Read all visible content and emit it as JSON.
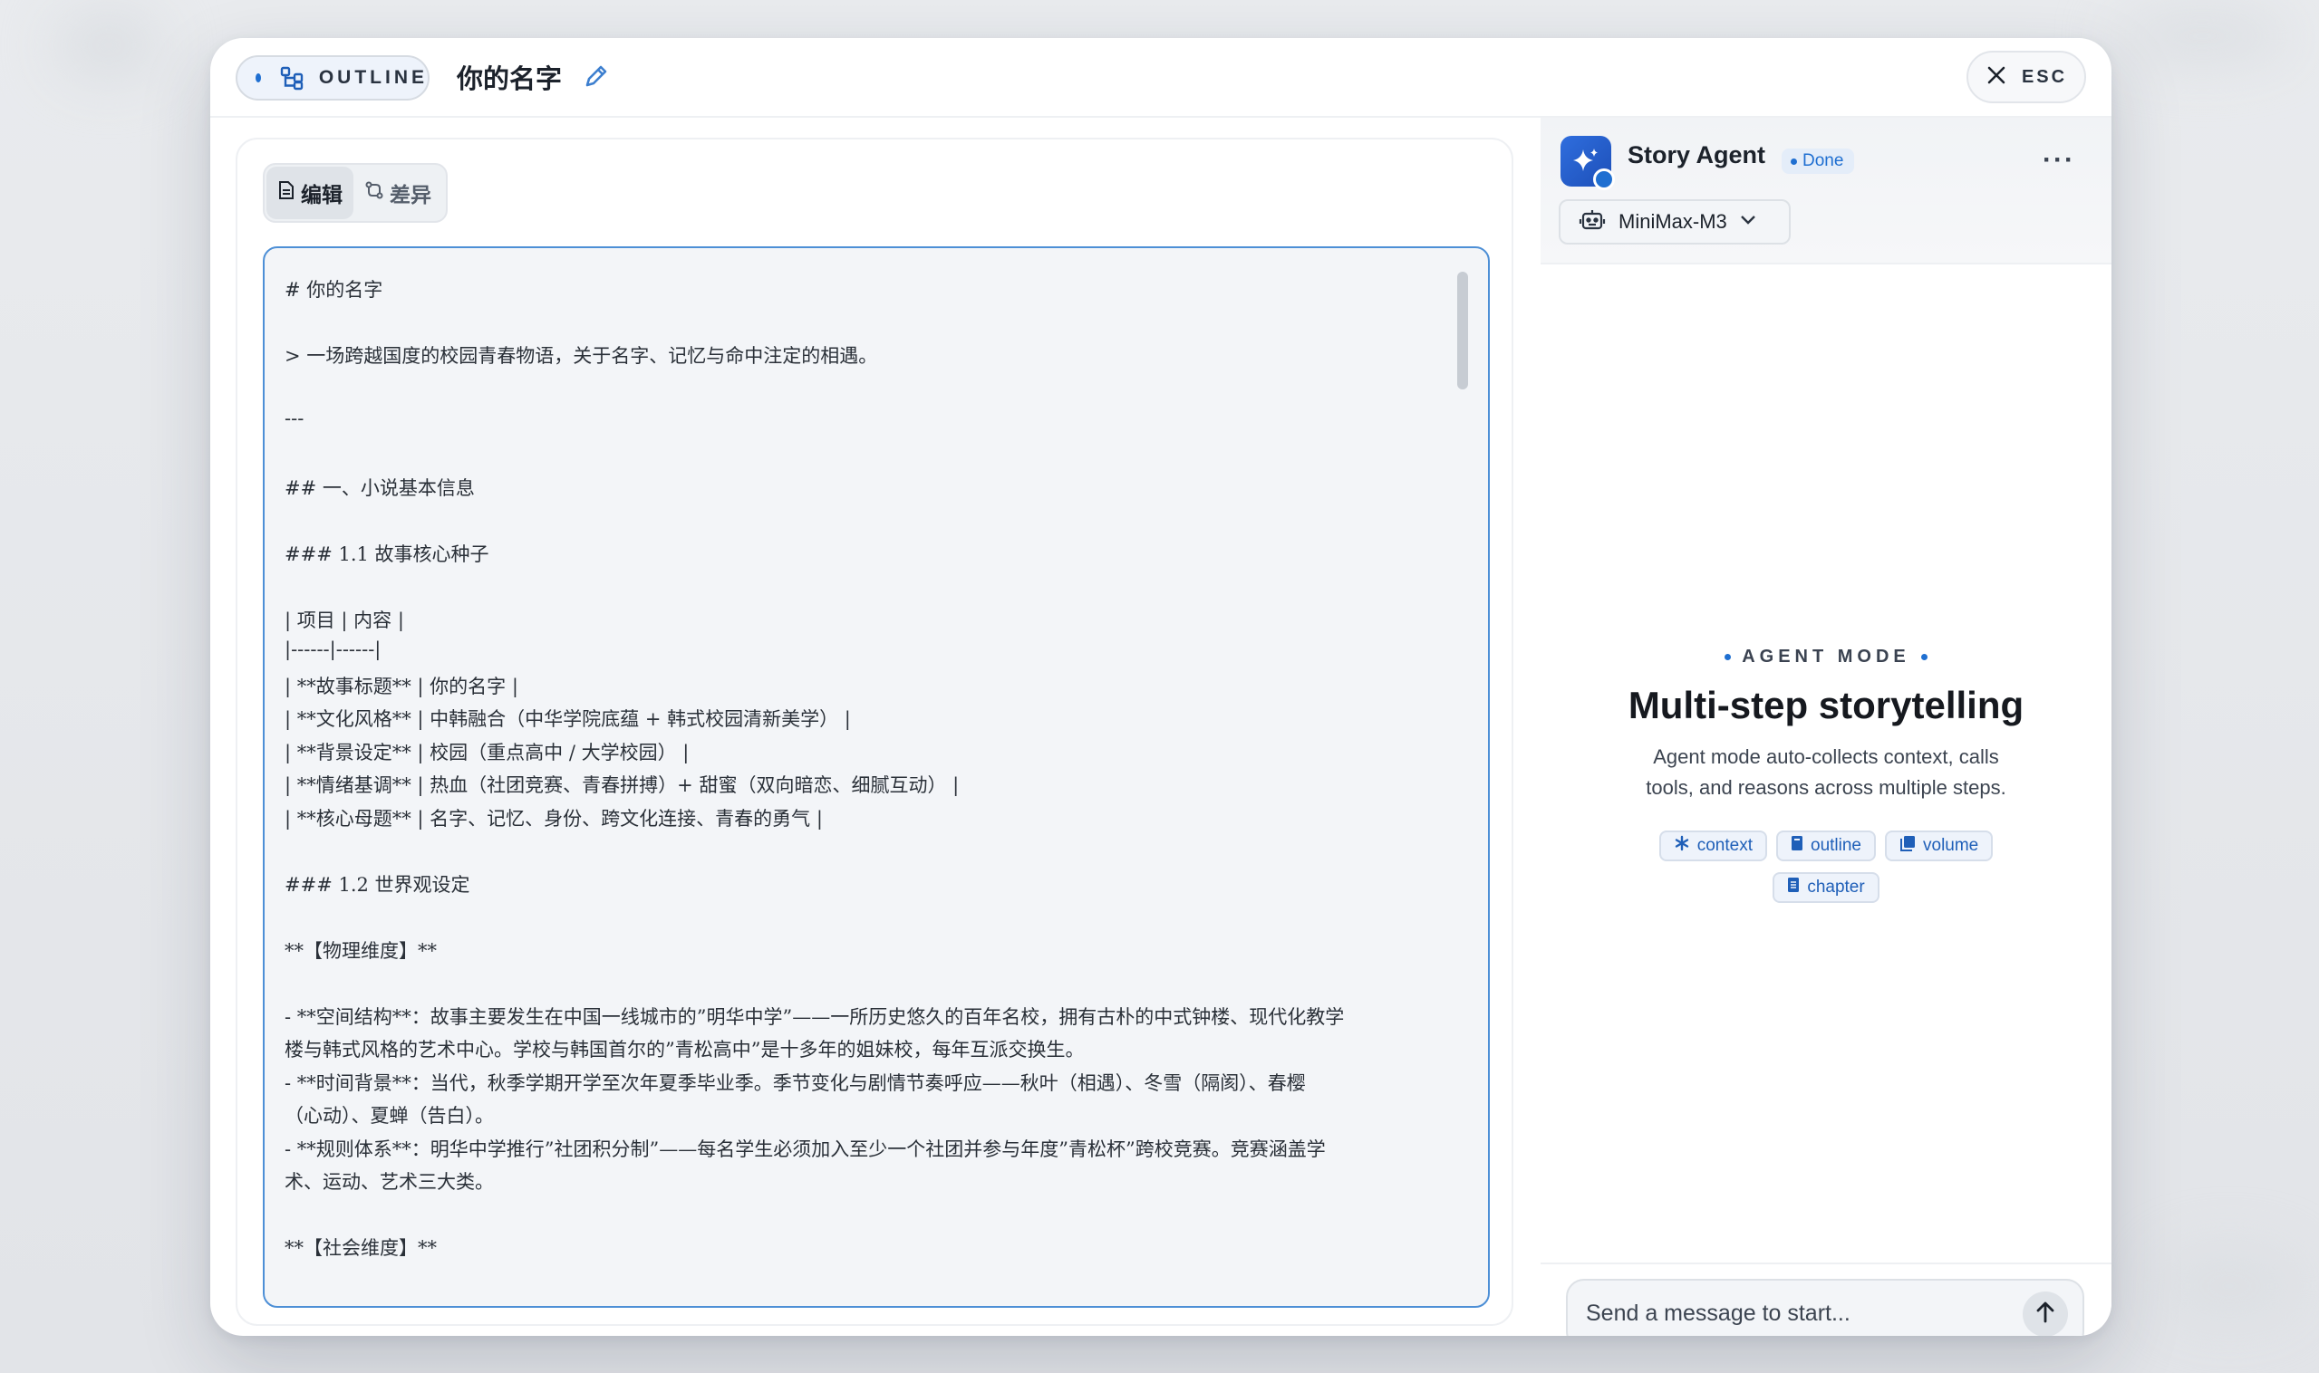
{
  "header": {
    "outline_label": "OUTLINE",
    "title": "你的名字",
    "esc_label": "ESC"
  },
  "editor": {
    "tabs": [
      {
        "label": "编辑",
        "active": true
      },
      {
        "label": "差异",
        "active": false
      }
    ],
    "lines": [
      "# 你的名字",
      "> 一场跨越国度的校园青春物语，关于名字、记忆与命中注定的相遇。",
      "---",
      "## 一、小说基本信息",
      "### 1.1 故事核心种子",
      "| 项目 | 内容 |",
      "|------|------|",
      "| **故事标题** | 你的名字 |",
      "| **文化风格** | 中韩融合（中华学院底蕴 + 韩式校园清新美学） |",
      "| **背景设定** | 校园（重点高中 / 大学校园） |",
      "| **情绪基调** | 热血（社团竞赛、青春拼搏）+ 甜蜜（双向暗恋、细腻互动） |",
      "| **核心母题** | 名字、记忆、身份、跨文化连接、青春的勇气 |",
      "### 1.2 世界观设定",
      "**【物理维度】**",
      "- **空间结构**：故事主要发生在中国一线城市的”明华中学”——一所历史悠久的百年名校，拥有古朴的中式钟楼、现代化教学",
      "楼与韩式风格的艺术中心。学校与韩国首尔的”青松高中”是十多年的姐妹校，每年互派交换生。",
      "- **时间背景**：当代，秋季学期开学至次年夏季毕业季。季节变化与剧情节奏呼应——秋叶（相遇）、冬雪（隔阂）、春樱",
      "（心动）、夏蝉（告白）。",
      "- **规则体系**：明华中学推行”社团积分制”——每名学生必须加入至少一个社团并参与年度”青松杯”跨校竞赛。竞赛涵盖学",
      "术、运动、艺术三大类。",
      "**【社会维度】**"
    ]
  },
  "agent": {
    "name": "Story Agent",
    "status": "Done",
    "model": "MiniMax-M3",
    "mode_label": "AGENT MODE",
    "title": "Multi-step storytelling",
    "description_line1": "Agent mode auto-collects context, calls",
    "description_line2": "tools, and reasons across multiple steps.",
    "chips": [
      "context",
      "outline",
      "volume",
      "chapter"
    ],
    "input_placeholder": "Send a message to start..."
  },
  "colors": {
    "accent": "#1f6fd1",
    "editor_border": "#4d8fd6"
  },
  "icons": {
    "outline": "tree-structure-icon",
    "edit": "pencil-icon",
    "close": "close-icon",
    "model": "robot-icon",
    "send": "arrow-up-icon"
  }
}
